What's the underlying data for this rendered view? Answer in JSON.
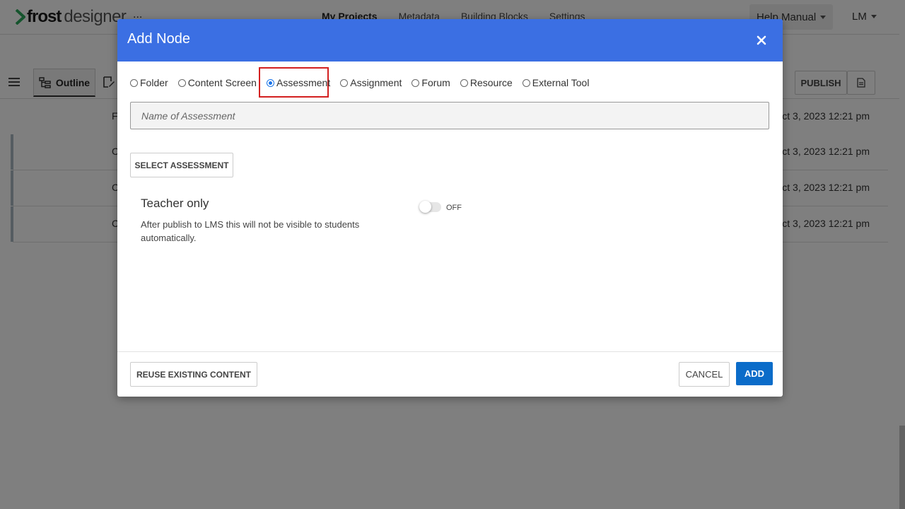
{
  "app": {
    "logo_frost": "frost",
    "logo_designer": "designer",
    "dots": "...",
    "nav": [
      {
        "label": "My Projects",
        "active": true
      },
      {
        "label": "Metadata",
        "active": false
      },
      {
        "label": "Building Blocks",
        "active": false
      },
      {
        "label": "Settings",
        "active": false
      }
    ],
    "help_label": "Help Manual",
    "user_initials": "LM",
    "toolbar": {
      "outline_label": "Outline",
      "publish_label": "PUBLISH"
    },
    "rows": [
      {
        "lead": "F",
        "date": "Oct 3, 2023 12:21 pm"
      },
      {
        "lead": "C",
        "date": "Oct 3, 2023 12:21 pm"
      },
      {
        "lead": "C",
        "date": "Oct 3, 2023 12:21 pm"
      },
      {
        "lead": "C",
        "date": "Oct 3, 2023 12:21 pm"
      }
    ]
  },
  "modal": {
    "title": "Add Node",
    "node_types": [
      {
        "label": "Folder",
        "checked": false
      },
      {
        "label": "Content Screen",
        "checked": false
      },
      {
        "label": "Assessment",
        "checked": true
      },
      {
        "label": "Assignment",
        "checked": false
      },
      {
        "label": "Forum",
        "checked": false
      },
      {
        "label": "Resource",
        "checked": false
      },
      {
        "label": "External Tool",
        "checked": false
      }
    ],
    "name_value": "",
    "name_placeholder": "Name of Assessment",
    "select_button": "SELECT ASSESSMENT",
    "teacher_only": {
      "title": "Teacher only",
      "description": "After publish to LMS this will not be visible to students automatically.",
      "toggle_state": "OFF"
    },
    "reuse_button": "REUSE EXISTING CONTENT",
    "cancel_button": "CANCEL",
    "add_button": "ADD"
  },
  "colors": {
    "modal_header": "#3b6fe3",
    "add_button": "#0b6cc9",
    "highlight": "#d32020",
    "logo_accent": "#2aa85a"
  },
  "icons": {
    "close": "close-icon",
    "menu": "hamburger-icon",
    "outline": "outline-tree-icon",
    "edit": "edit-icon",
    "document": "document-icon"
  }
}
